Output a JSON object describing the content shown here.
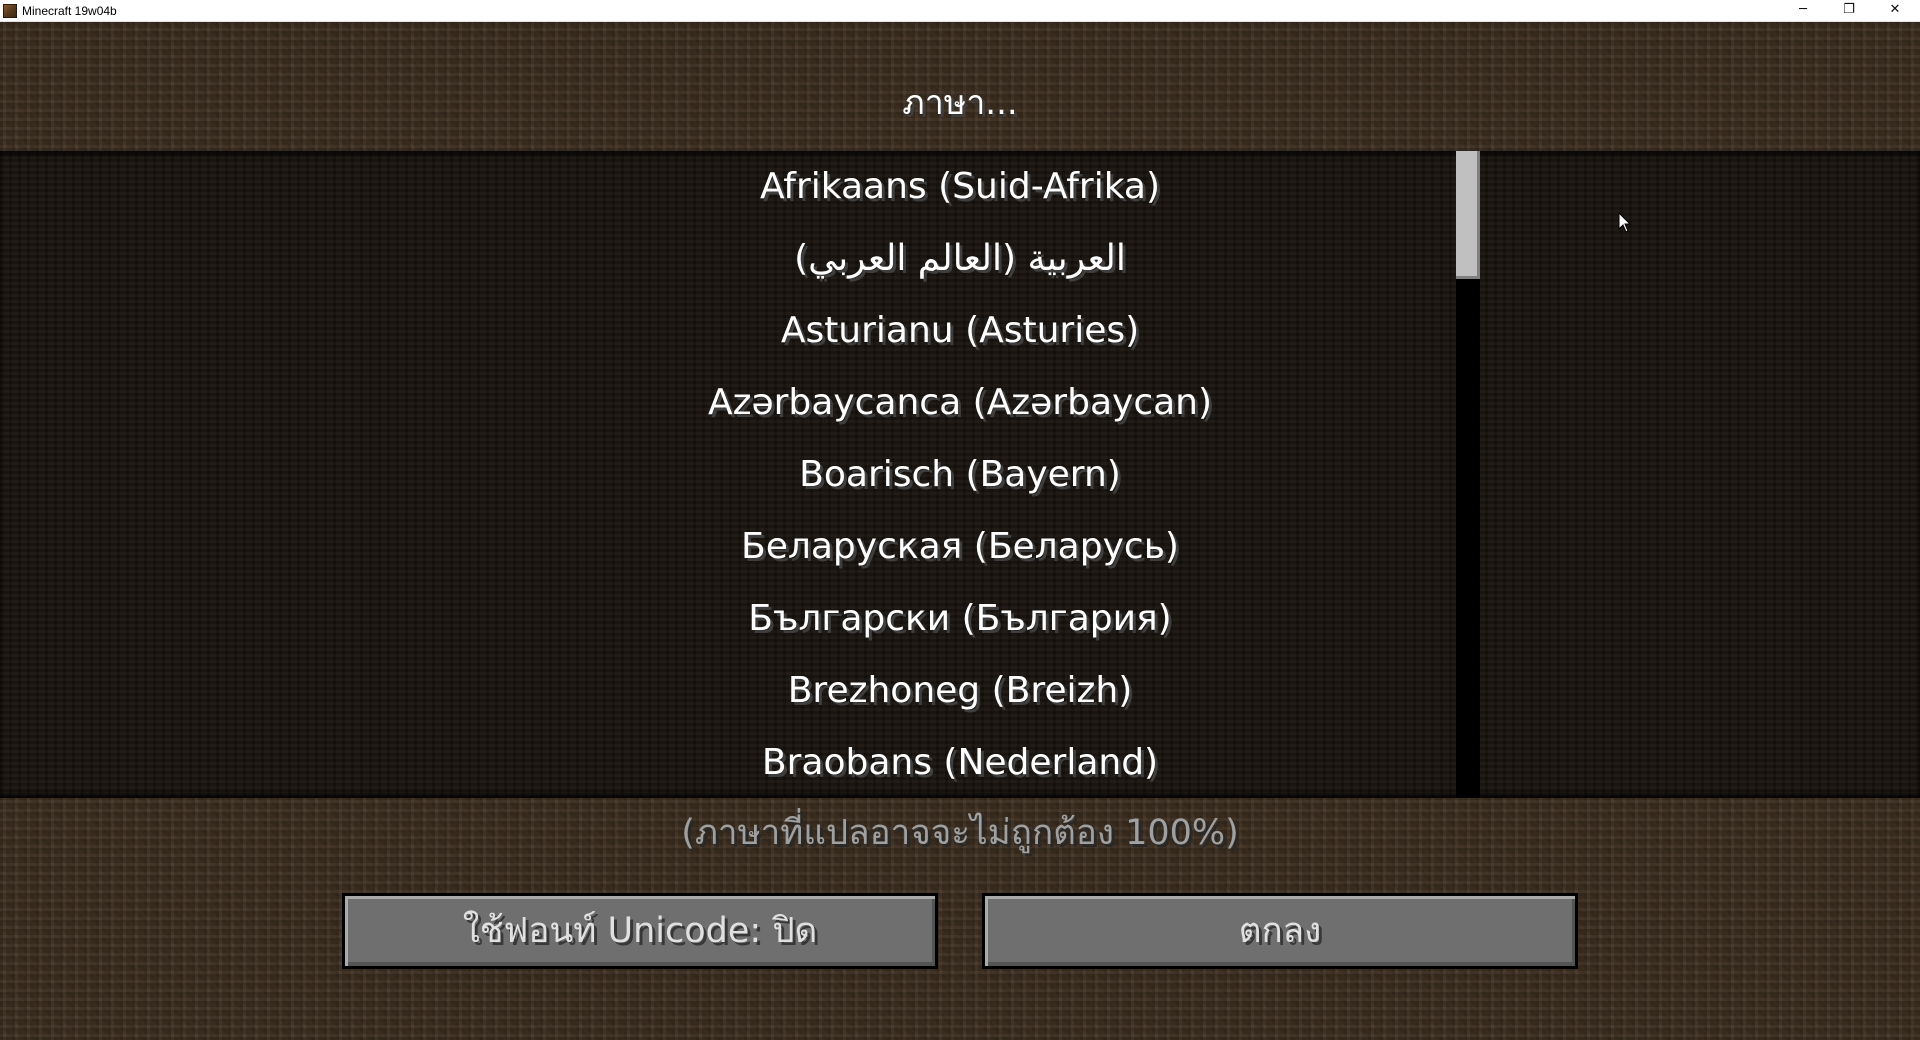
{
  "window": {
    "title": "Minecraft 19w04b",
    "minimize_symbol": "─",
    "restore_symbol": "❐",
    "close_symbol": "✕"
  },
  "screen": {
    "title": "ภาษา..."
  },
  "languages": [
    "Afrikaans (Suid-Afrika)",
    "العربية (العالم العربي)",
    "Asturianu (Asturies)",
    "Azərbaycanca (Azərbaycan)",
    "Boarisch (Bayern)",
    "Беларуская (Беларусь)",
    "Български (България)",
    "Brezhoneg (Breizh)",
    "Braobans (Nederland)"
  ],
  "footer": {
    "translation_note": "(ภาษาที่แปลอาจจะไม่ถูกต้อง 100%)",
    "unicode_font_button": "ใช้ฟอนท์ Unicode: ปิด",
    "done_button": "ตกลง"
  },
  "colors": {
    "text_primary": "#ffffff",
    "text_secondary": "#a0a0a0",
    "button_face": "#6f6f6f",
    "scrollbar_thumb": "#c0c0c0"
  },
  "icons": [
    "minecraft-app-icon",
    "minimize-icon",
    "restore-icon",
    "close-icon",
    "mouse-cursor-icon"
  ]
}
